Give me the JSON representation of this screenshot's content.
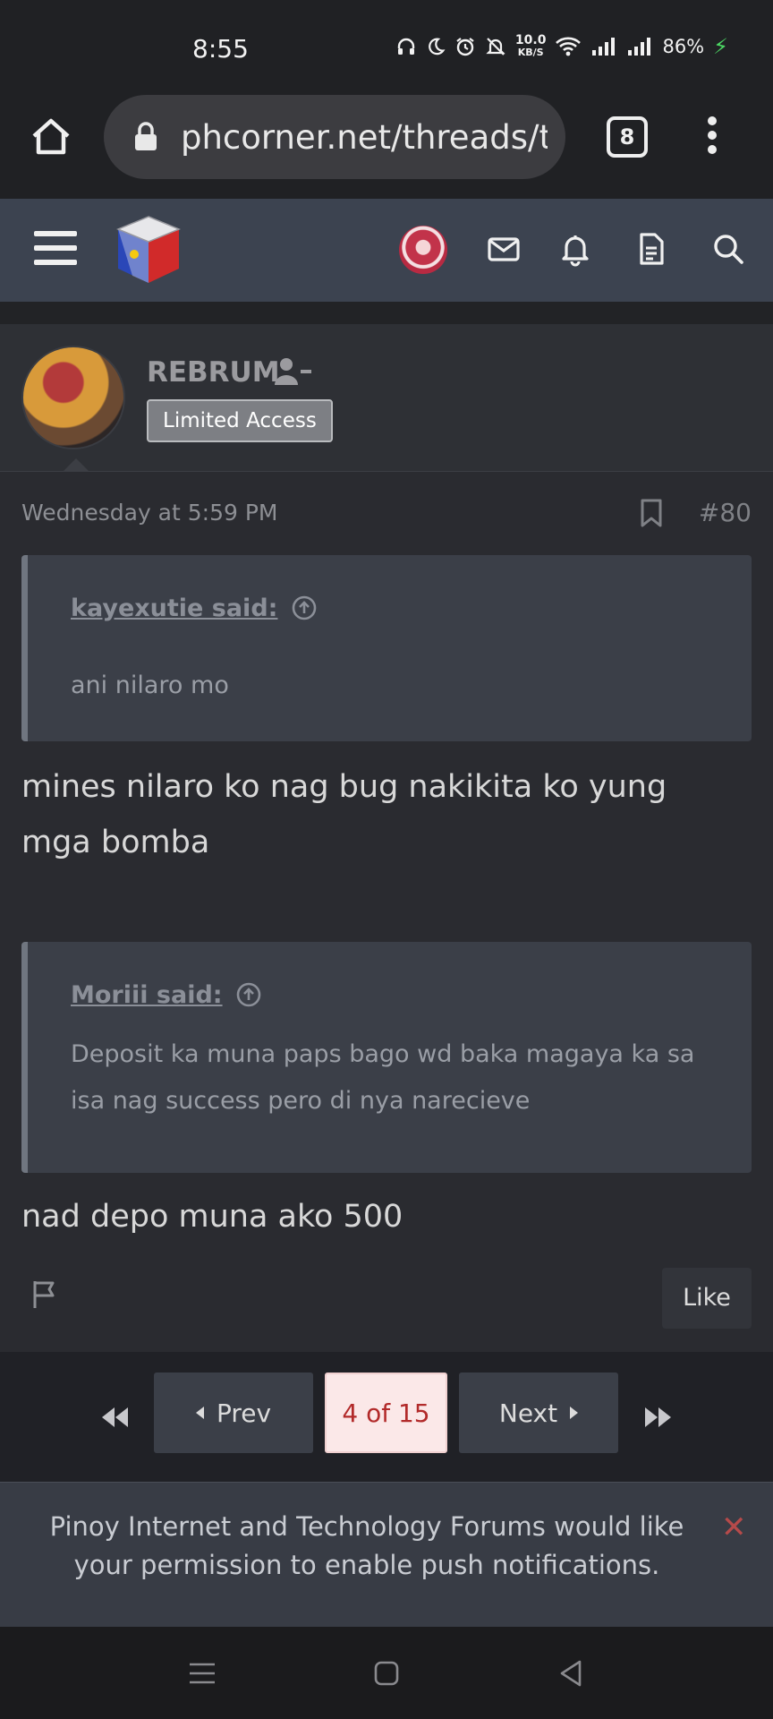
{
  "status_bar": {
    "time": "8:55",
    "net_speed_value": "10.0",
    "net_speed_unit": "KB/S",
    "battery": "86%"
  },
  "browser": {
    "url": "phcorner.net/threads/tri",
    "tab_count": "8"
  },
  "site_nav": {
    "icons": [
      "menu-icon",
      "site-logo",
      "user-avatar",
      "mail-icon",
      "bell-icon",
      "document-icon",
      "search-icon"
    ]
  },
  "post": {
    "username": "REBRUM",
    "badge": "Limited Access",
    "timestamp": "Wednesday at 5:59 PM",
    "post_number": "#80",
    "quotes": [
      {
        "author": "kayexutie said:",
        "body": "ani nilaro mo"
      },
      {
        "author": "Moriii said:",
        "body": "Deposit ka muna paps bago wd baka magaya ka sa isa nag success pero di nya narecieve"
      }
    ],
    "replies": [
      "mines nilaro ko nag bug nakikita ko yung mga bomba",
      "nad depo muna ako 500"
    ],
    "like_label": "Like"
  },
  "pagination": {
    "prev_label": "Prev",
    "current_label": "4 of 15",
    "next_label": "Next"
  },
  "push_banner": {
    "message": "Pinoy Internet and Technology Forums would like your permission to enable push notifications.",
    "close_label": "✕"
  },
  "colors": {
    "nav_bg": "#3c4350",
    "post_bg": "#2a2b30",
    "quote_bg": "#3b3f48",
    "current_page_bg": "#fbe8e8",
    "current_page_text": "#b22a2a",
    "close_red": "#b54a4a"
  }
}
